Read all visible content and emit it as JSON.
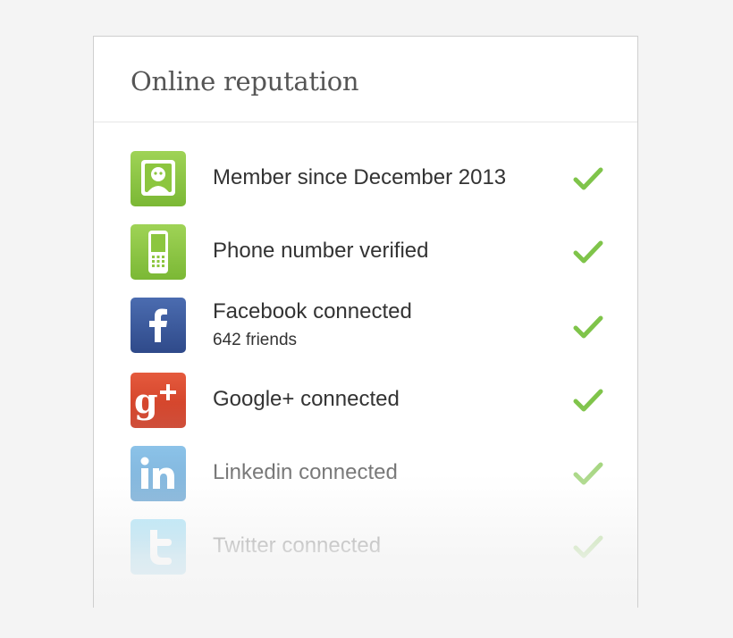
{
  "card": {
    "title": "Online reputation"
  },
  "items": [
    {
      "label": "Member since December 2013",
      "sublabel": "",
      "icon": "member-icon",
      "verified": true,
      "color": "#8cc63f"
    },
    {
      "label": "Phone number verified",
      "sublabel": "",
      "icon": "phone-icon",
      "verified": true,
      "color": "#8cc63f"
    },
    {
      "label": "Facebook connected",
      "sublabel": "642 friends",
      "icon": "facebook-icon",
      "verified": true,
      "color": "#3b5998"
    },
    {
      "label": "Google+ connected",
      "sublabel": "",
      "icon": "google-plus-icon",
      "verified": true,
      "color": "#d9402b"
    },
    {
      "label": "Linkedin connected",
      "sublabel": "",
      "icon": "linkedin-icon",
      "verified": true,
      "color": "#2b86c5"
    },
    {
      "label": "Twitter connected",
      "sublabel": "",
      "icon": "twitter-icon",
      "verified": true,
      "color": "#3fb6e8"
    }
  ],
  "colors": {
    "check": "#7fc44a",
    "background": "#f4f4f4",
    "text": "#333333",
    "title": "#555555"
  }
}
